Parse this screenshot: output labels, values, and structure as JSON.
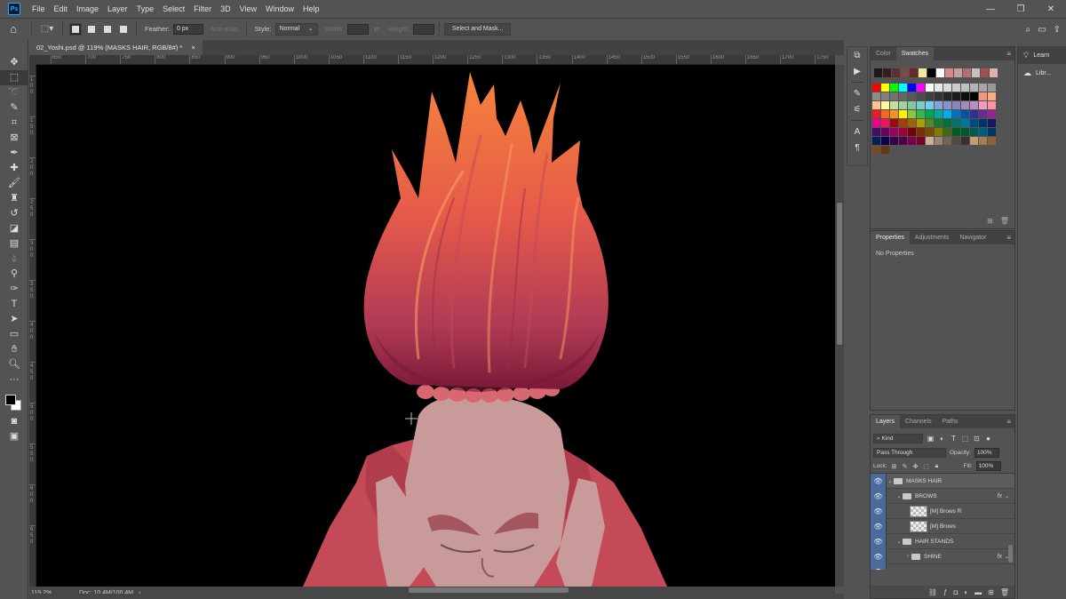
{
  "menu": {
    "logo": "Ps",
    "items": [
      "File",
      "Edit",
      "Image",
      "Layer",
      "Type",
      "Select",
      "Filter",
      "3D",
      "View",
      "Window",
      "Help"
    ],
    "window_controls": [
      "—",
      "❐",
      "✕"
    ]
  },
  "options": {
    "feather_label": "Feather:",
    "feather_value": "0 px",
    "antialias_label": "Anti-alias",
    "style_label": "Style:",
    "style_value": "Normal",
    "width_label": "Width:",
    "height_label": "Height:",
    "select_mask_label": "Select and Mask..."
  },
  "document": {
    "tab_title": "02_Yoshi.psd @ 119% (MASKS HAIR, RGB/8#) *",
    "close": "×"
  },
  "ruler": {
    "top_labels": [
      "650",
      "700",
      "750",
      "800",
      "850",
      "900",
      "950",
      "1000",
      "1050",
      "1100",
      "1150",
      "1200",
      "1250",
      "1300",
      "1350",
      "1400",
      "1450",
      "1500",
      "1550",
      "1600",
      "1650",
      "1700",
      "1750"
    ],
    "left_labels": [
      "1",
      "0",
      "0",
      "1",
      "5",
      "0",
      "2",
      "0",
      "0",
      "2",
      "5",
      "0",
      "3",
      "0",
      "0",
      "3",
      "5",
      "0",
      "4",
      "0",
      "0",
      "4",
      "5",
      "0",
      "5",
      "0",
      "0",
      "5",
      "5",
      "0",
      "6",
      "0",
      "0",
      "6",
      "5",
      "0"
    ]
  },
  "status": {
    "zoom": "119.2%",
    "doc_size": "Doc: 10.4M/100.4M",
    "arrow": "›"
  },
  "swatches_panel": {
    "tabs": [
      "Color",
      "Swatches"
    ],
    "active_tab": "Swatches",
    "recent": [
      "#1a1a1a",
      "#3a1a1a",
      "#5c3030",
      "#7a4a4a",
      "#6a2a2a",
      "#f0e8a0",
      "#000000",
      "#ffffff",
      "#d88a8a",
      "#c4a0a0",
      "#b07070",
      "#c8c0c0",
      "#a05050",
      "#e0b0b0"
    ],
    "grid": [
      "#ff0000",
      "#ffff00",
      "#00ff00",
      "#00ffff",
      "#0000ff",
      "#ff00ff",
      "#ffffff",
      "#e6e6e6",
      "#d9d9d9",
      "#cccccc",
      "#bfbfbf",
      "#b3b3b3",
      "#a6a6a6",
      "#999999",
      "#8c8c8c",
      "#808080",
      "#737373",
      "#666666",
      "#595959",
      "#4d4d4d",
      "#404040",
      "#333333",
      "#262626",
      "#1a1a1a",
      "#0d0d0d",
      "#000000",
      "#f7977a",
      "#f9ad81",
      "#fdc68a",
      "#fff79a",
      "#c4df9b",
      "#a2d39c",
      "#82ca9d",
      "#7bcdc8",
      "#6ecff6",
      "#7ea7d8",
      "#8493ca",
      "#8882be",
      "#a187be",
      "#bc8dbf",
      "#f49ac2",
      "#f6989d",
      "#ed1c24",
      "#f26522",
      "#f7941d",
      "#fff200",
      "#8dc73f",
      "#39b54a",
      "#00a651",
      "#00a99d",
      "#00aeef",
      "#0072bc",
      "#0054a6",
      "#2e3192",
      "#662d91",
      "#92278f",
      "#ec008c",
      "#ed145b",
      "#9e0b0f",
      "#a0410d",
      "#a36209",
      "#aba000",
      "#598527",
      "#1a7b30",
      "#007236",
      "#00746b",
      "#0076a3",
      "#004b80",
      "#003471",
      "#1b1464",
      "#440e62",
      "#630460",
      "#9e005d",
      "#9e0039",
      "#790000",
      "#7b2e00",
      "#7d4900",
      "#827b00",
      "#406618",
      "#005e20",
      "#005826",
      "#005952",
      "#005b7f",
      "#003663",
      "#002157",
      "#0d004c",
      "#32004b",
      "#4b0049",
      "#7b0046",
      "#7a0026",
      "#c7b299",
      "#998675",
      "#736357",
      "#534741",
      "#37302d",
      "#c69c6d",
      "#a67c52",
      "#8c6239",
      "#754c24",
      "#603913"
    ]
  },
  "properties_panel": {
    "tabs": [
      "Properties",
      "Adjustments",
      "Navigator"
    ],
    "active_tab": "Properties",
    "body_text": "No Properties"
  },
  "layers_panel": {
    "tabs": [
      "Layers",
      "Channels",
      "Paths"
    ],
    "active_tab": "Layers",
    "kind_label": "Kind",
    "blend_mode": "Pass Through",
    "opacity_label": "Opacity:",
    "opacity_value": "100%",
    "lock_label": "Lock:",
    "fill_label": "Fill:",
    "fill_value": "100%",
    "layers": [
      {
        "name": "MASKS HAIR",
        "type": "folder",
        "selected": true,
        "fx": false
      },
      {
        "name": "BROWS",
        "type": "folder",
        "selected": false,
        "fx": true
      },
      {
        "name": "[M] Brows R",
        "type": "layer",
        "selected": false,
        "fx": false
      },
      {
        "name": "[M] Brows",
        "type": "layer",
        "selected": false,
        "fx": false
      },
      {
        "name": "HAIR STANDS",
        "type": "folder",
        "selected": false,
        "fx": false
      },
      {
        "name": "SHINE",
        "type": "folder",
        "selected": false,
        "fx": true
      }
    ],
    "fx_label": "fx"
  },
  "learn_panel": {
    "items": [
      {
        "label": "Learn",
        "icon": "lightbulb-icon"
      },
      {
        "label": "Libr...",
        "icon": "libraries-icon"
      }
    ]
  },
  "colors": {
    "foreground": "#000000",
    "background": "#ffffff",
    "layer_visible_bg": "#4a6a9a",
    "hair_top": "#f47c3c",
    "hair_bottom": "#8a2040",
    "jacket": "#c44a58",
    "face": "#c99a9a"
  }
}
